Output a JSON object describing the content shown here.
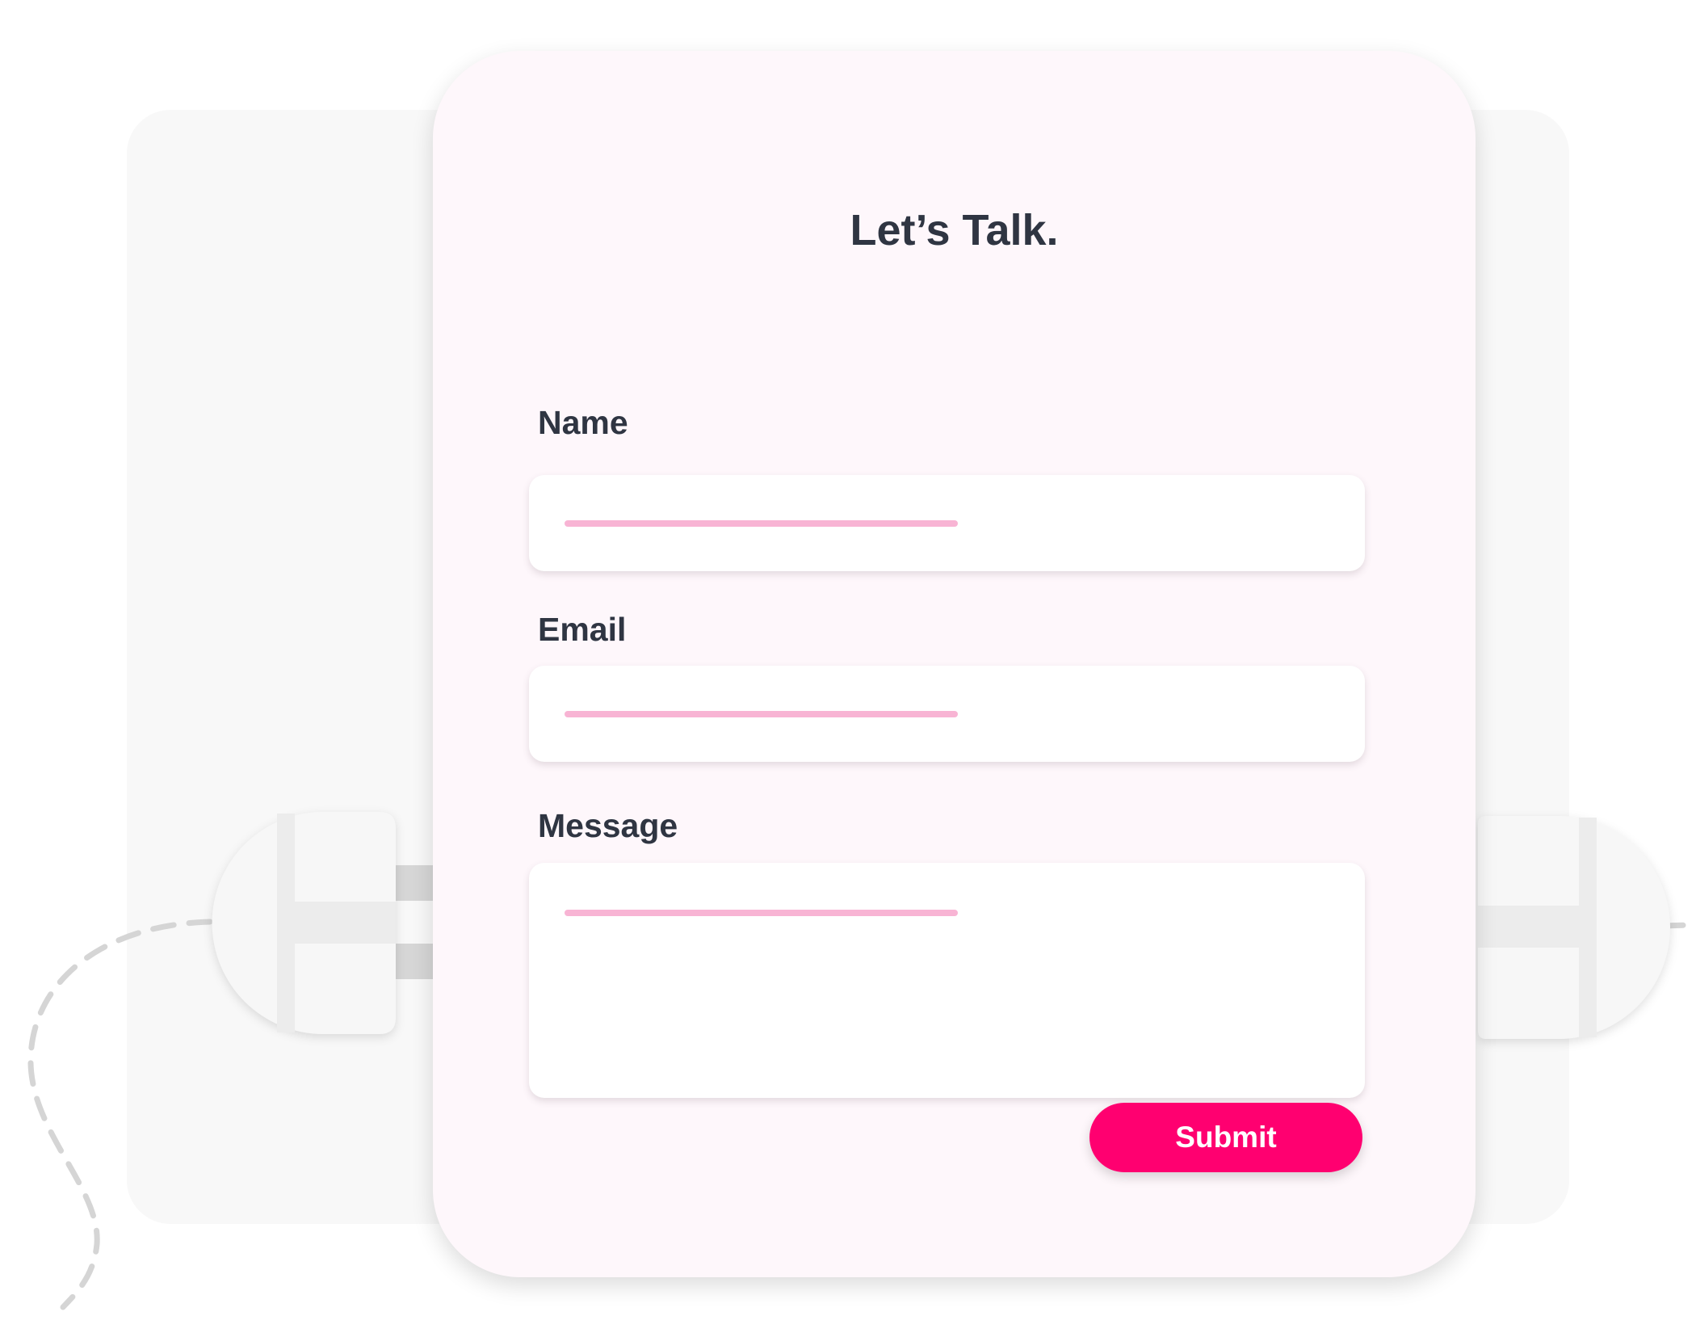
{
  "form": {
    "title": "Let’s Talk.",
    "fields": [
      {
        "label": "Name",
        "value": ""
      },
      {
        "label": "Email",
        "value": ""
      },
      {
        "label": "Message",
        "value": ""
      }
    ],
    "submit_label": "Submit"
  },
  "colors": {
    "accent": "#ff0070",
    "placeholder_line": "#f8b4d4",
    "card_background": "#fef7fb",
    "text": "#2f3542"
  },
  "icons": [
    "plug-left-icon",
    "plug-right-icon",
    "cable-dashed-line"
  ]
}
